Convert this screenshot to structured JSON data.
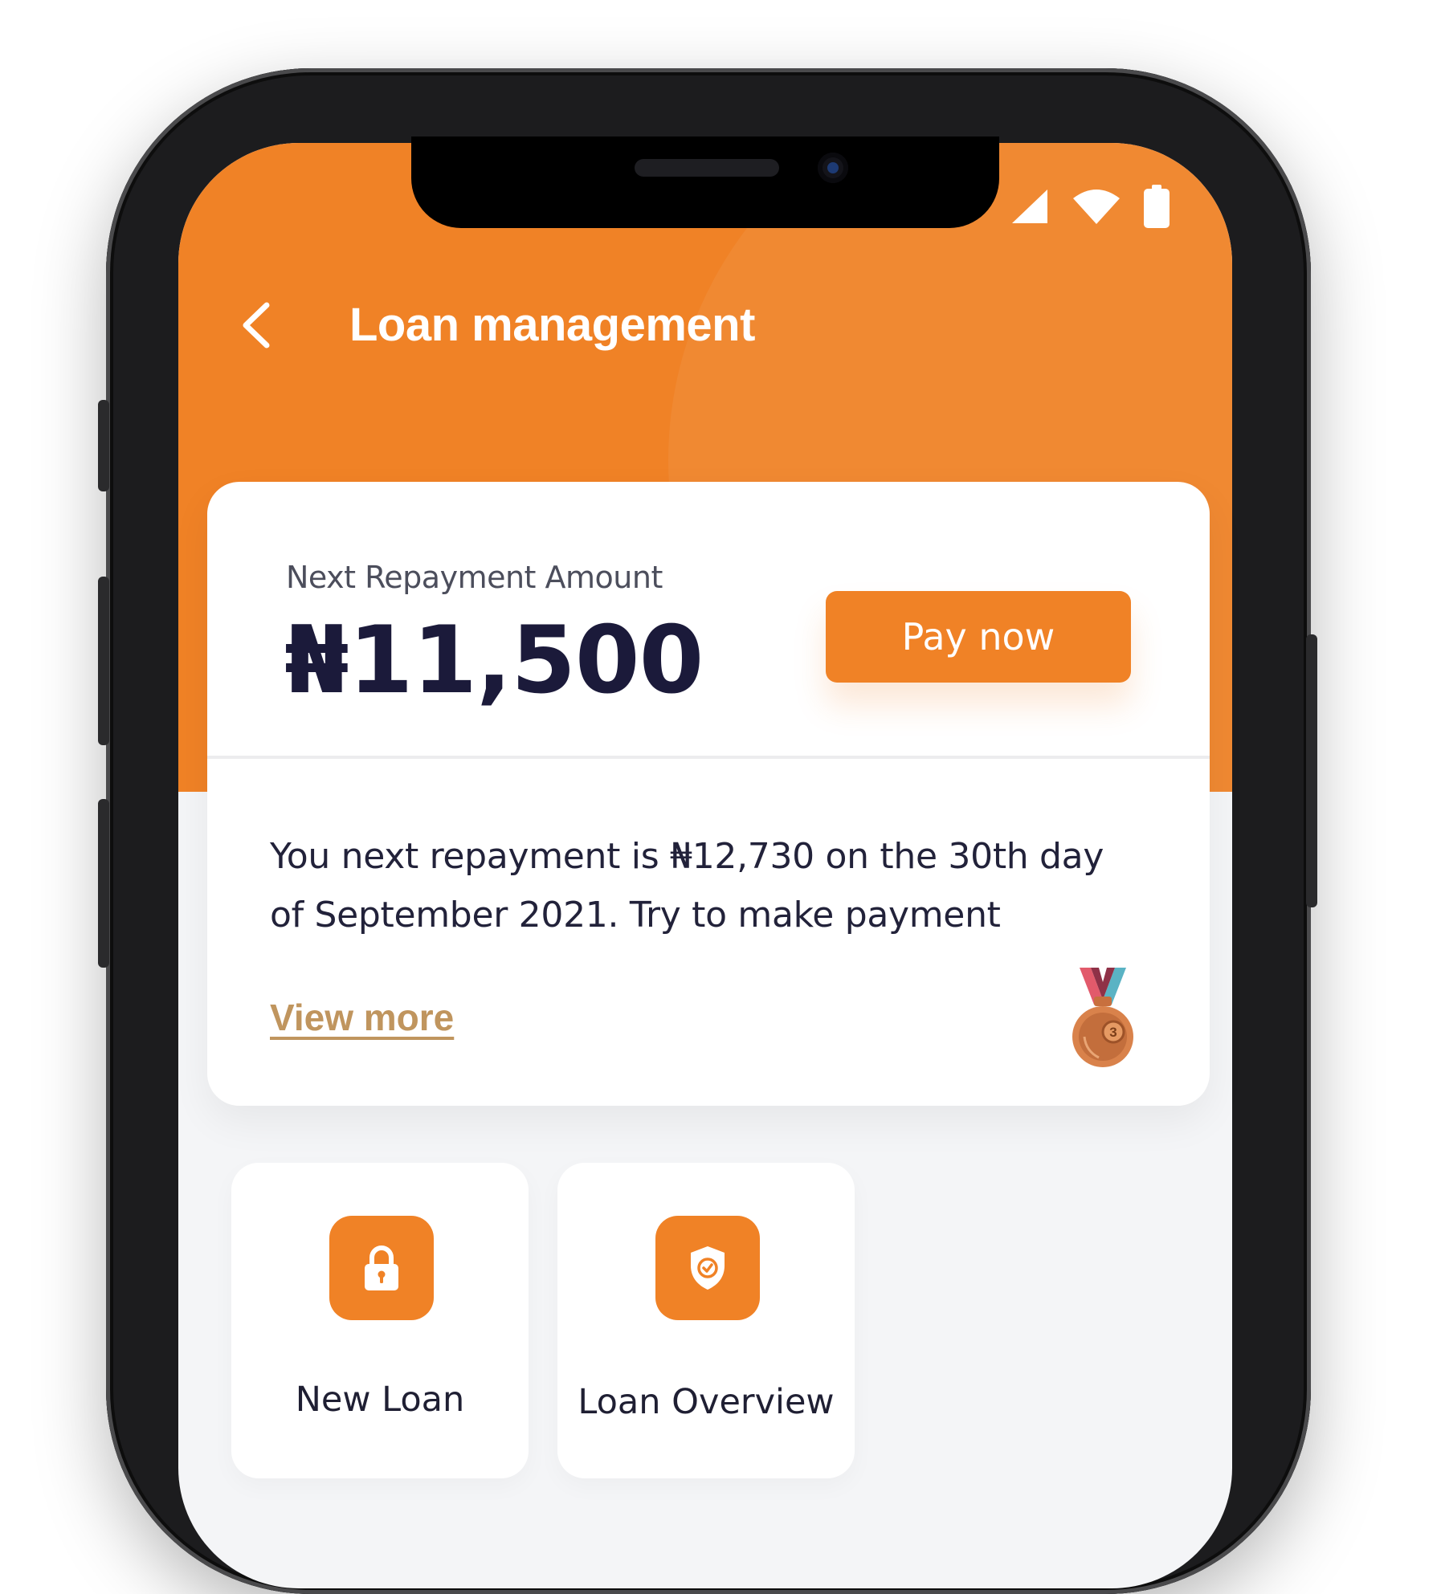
{
  "header": {
    "title": "Loan management"
  },
  "repayment": {
    "label": "Next Repayment Amount",
    "amount": "₦11,500",
    "pay_button_label": "Pay now",
    "message": "You next repayment is ₦12,730 on the 30th day of September 2021. Try to make payment",
    "view_more_label": "View more",
    "medal_number": "3"
  },
  "actions": [
    {
      "label": "New Loan",
      "icon": "lock-icon"
    },
    {
      "label": "Loan Overview",
      "icon": "shield-check-icon"
    }
  ],
  "status_bar": {
    "icons": [
      "signal-icon",
      "wifi-icon",
      "battery-icon"
    ]
  },
  "colors": {
    "accent": "#f08226",
    "amount_text": "#1b1a3a",
    "link": "#c0955e",
    "screen_background": "#f4f5f7"
  }
}
